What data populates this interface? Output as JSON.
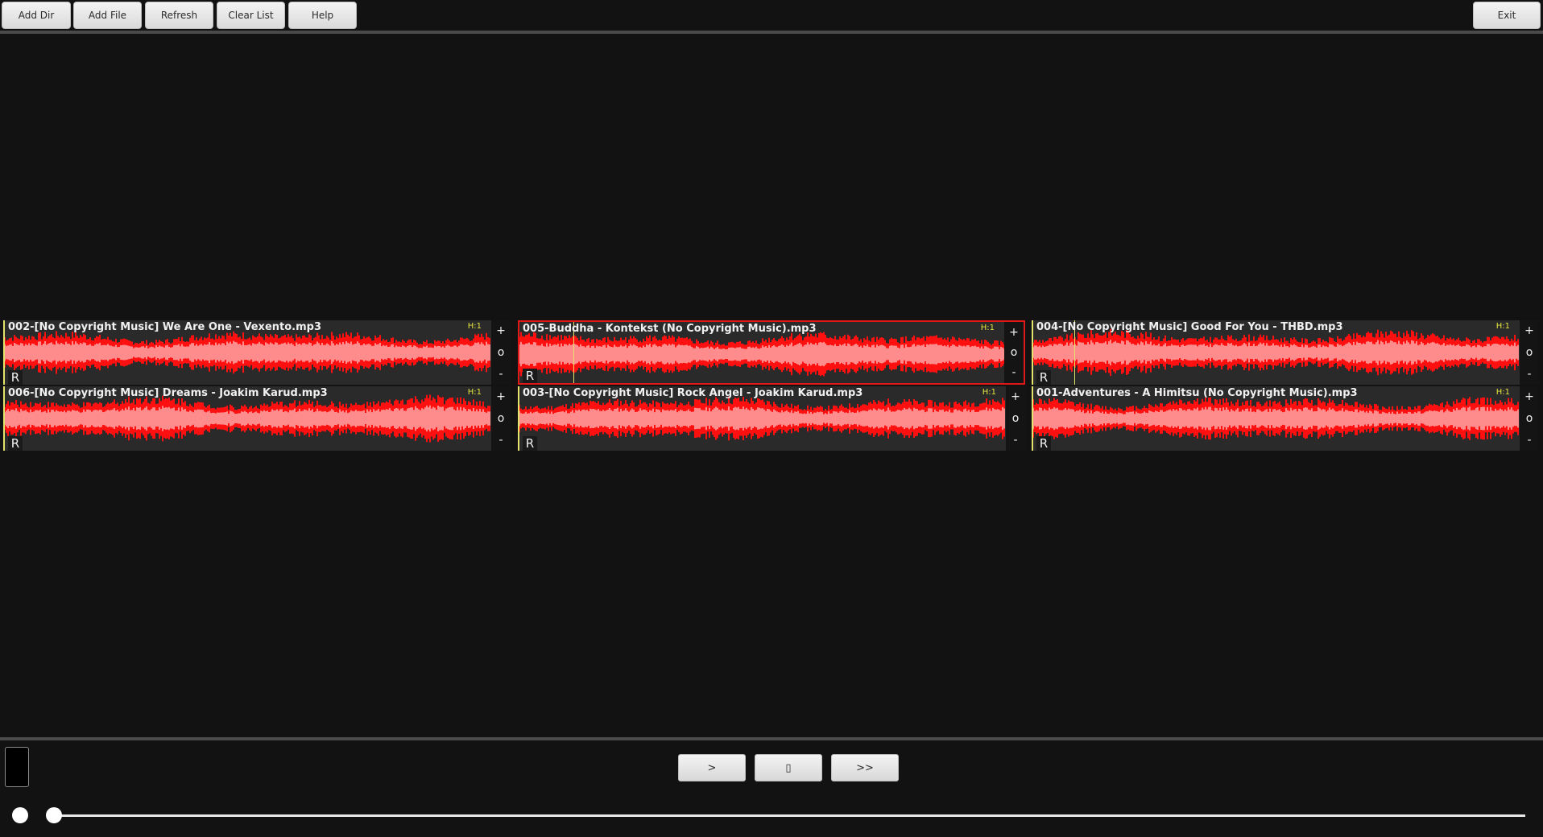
{
  "toolbar": {
    "add_dir": "Add Dir",
    "add_file": "Add File",
    "refresh": "Refresh",
    "clear_list": "Clear List",
    "help": "Help",
    "exit": "Exit"
  },
  "tracks": [
    {
      "title": "002-[No Copyright Music] We Are One - Vexento.mp3",
      "h": "H:1",
      "r": "R"
    },
    {
      "title": "005-Buddha - Kontekst (No Copyright Music).mp3",
      "h": "H:1",
      "r": "R"
    },
    {
      "title": "004-[No Copyright Music] Good For You - THBD.mp3",
      "h": "H:1",
      "r": "R"
    },
    {
      "title": "006-[No Copyright Music] Dreams - Joakim Karud.mp3",
      "h": "H:1",
      "r": "R"
    },
    {
      "title": "003-[No Copyright Music] Rock Angel - Joakim Karud.mp3",
      "h": "H:1",
      "r": "R"
    },
    {
      "title": "001-Adventures - A Himitsu (No Copyright Music).mp3",
      "h": "H:1",
      "r": "R"
    }
  ],
  "track_side": {
    "plus": "+",
    "zero": "o",
    "minus": "-"
  },
  "player": {
    "play": ">",
    "stop": "▯",
    "next": ">>"
  },
  "colors": {
    "wave_outer": "#ff1010",
    "wave_inner": "#ff8c8c",
    "selected_border": "#e01818",
    "cursor": "#e4e46a"
  }
}
